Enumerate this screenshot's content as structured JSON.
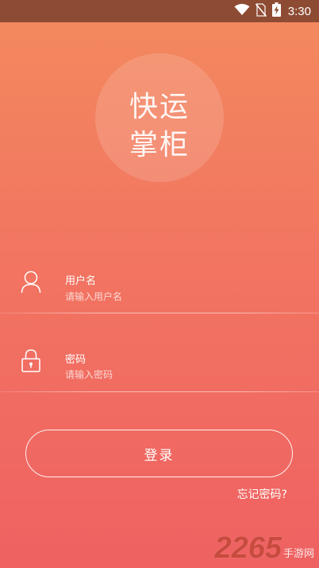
{
  "status_bar": {
    "time": "3:30",
    "icons": [
      "wifi-icon",
      "no-sim-icon",
      "battery-charging-icon"
    ]
  },
  "logo": {
    "line1": "快运",
    "line2": "掌柜"
  },
  "form": {
    "username": {
      "label": "用户名",
      "placeholder": "请输入用户名",
      "value": "",
      "icon": "user-icon"
    },
    "password": {
      "label": "密码",
      "placeholder": "请输入密码",
      "value": "",
      "icon": "lock-icon"
    }
  },
  "actions": {
    "login_label": "登录",
    "forgot_password_label": "忘记密码?"
  },
  "watermark": {
    "number": "2265",
    "site": "手游网"
  },
  "colors": {
    "status_bar": "#8e4b33",
    "gradient_top": "#f38a5e",
    "gradient_bottom": "#ef6162",
    "text": "#ffffff"
  }
}
